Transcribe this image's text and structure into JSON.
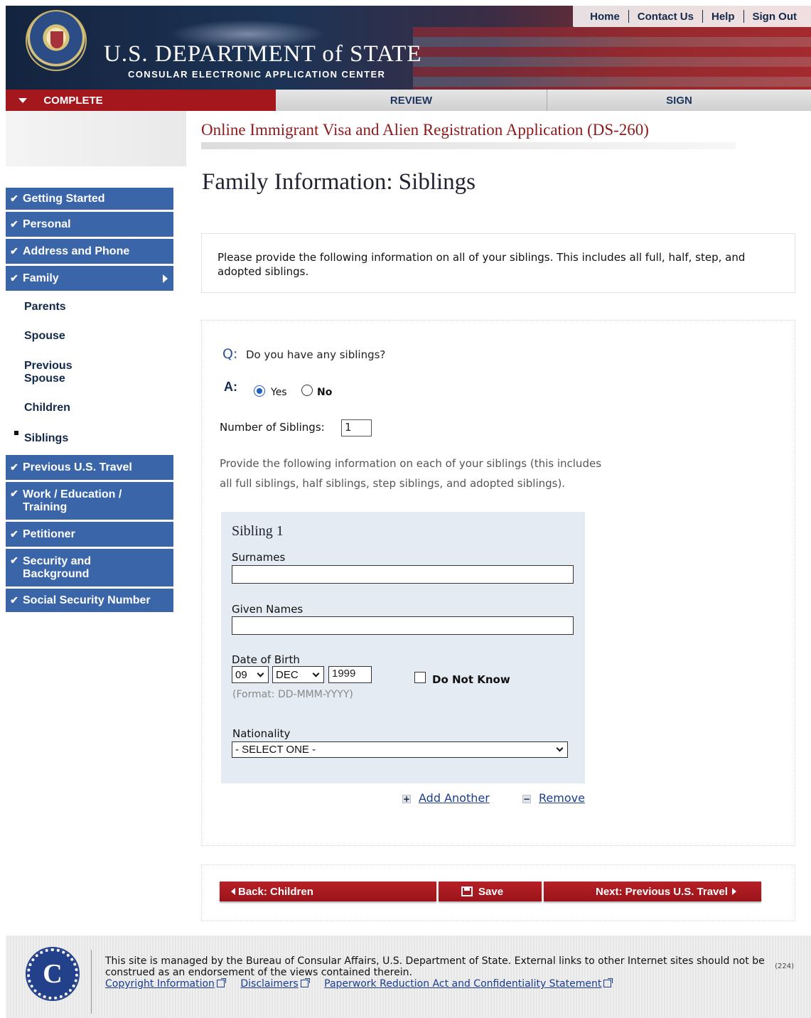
{
  "header": {
    "links": [
      "Home",
      "Contact Us",
      "Help",
      "Sign Out"
    ],
    "title": "U.S. DEPARTMENT of STATE",
    "subtitle": "CONSULAR ELECTRONIC APPLICATION CENTER"
  },
  "progress_tabs": [
    "COMPLETE",
    "REVIEW",
    "SIGN"
  ],
  "app_title": "Online Immigrant Visa and Alien Registration Application (DS-260)",
  "page_title": "Family Information: Siblings",
  "sidebar": {
    "items": [
      {
        "label": "Getting Started",
        "type": "main"
      },
      {
        "label": "Personal",
        "type": "main"
      },
      {
        "label": "Address and Phone",
        "type": "main"
      },
      {
        "label": "Family",
        "type": "main",
        "expanded": true
      },
      {
        "label": "Parents",
        "type": "sub"
      },
      {
        "label": "Spouse",
        "type": "sub"
      },
      {
        "label": "Previous Spouse",
        "type": "sub"
      },
      {
        "label": "Children",
        "type": "sub"
      },
      {
        "label": "Siblings",
        "type": "sub",
        "current": true
      },
      {
        "label": "Previous U.S. Travel",
        "type": "main"
      },
      {
        "label": "Work / Education / Training",
        "type": "main"
      },
      {
        "label": "Petitioner",
        "type": "main"
      },
      {
        "label": "Security and Background",
        "type": "main"
      },
      {
        "label": "Social Security Number",
        "type": "main"
      }
    ]
  },
  "instructions": "Please provide the following information on all of your siblings. This includes all full, half, step, and adopted siblings.",
  "question": {
    "q_marker": "Q:",
    "text": "Do you have any siblings?",
    "a_marker": "A:",
    "options": [
      "Yes",
      "No"
    ],
    "selected": "Yes"
  },
  "number_of_siblings": {
    "label": "Number of Siblings:",
    "value": "1"
  },
  "provide_text": "Provide the following information on each of your siblings (this includes all full siblings, half siblings, step siblings, and adopted siblings).",
  "sibling": {
    "title": "Sibling 1",
    "surnames_label": "Surnames",
    "surnames_value": "",
    "given_names_label": "Given Names",
    "given_names_value": "",
    "dob_label": "Date of Birth",
    "dob_day": "09",
    "dob_month": "DEC",
    "dob_year": "1999",
    "dob_format": "(Format: DD-MMM-YYYY)",
    "do_not_know_label": "Do Not Know",
    "do_not_know_checked": false,
    "nationality_label": "Nationality",
    "nationality_value": "- SELECT ONE -"
  },
  "actions": {
    "add_another": "Add Another",
    "remove": "Remove",
    "add_icon": "+",
    "remove_icon": "−"
  },
  "nav_buttons": {
    "back": "Back: Children",
    "save": "Save",
    "next": "Next: Previous U.S. Travel"
  },
  "footer": {
    "logo_letter": "C",
    "text": "This site is managed by the Bureau of Consular Affairs, U.S. Department of State. External links to other Internet sites should not be construed as an endorsement of the views contained therein.",
    "links": [
      "Copyright Information",
      "Disclaimers",
      "Paperwork Reduction Act and Confidentiality Statement"
    ],
    "code": "(224)"
  },
  "colors": {
    "brand_red": "#a3171d",
    "nav_blue": "#3a65a8",
    "panel_blue": "#e4ebf3",
    "link_blue": "#1a3d8f"
  }
}
